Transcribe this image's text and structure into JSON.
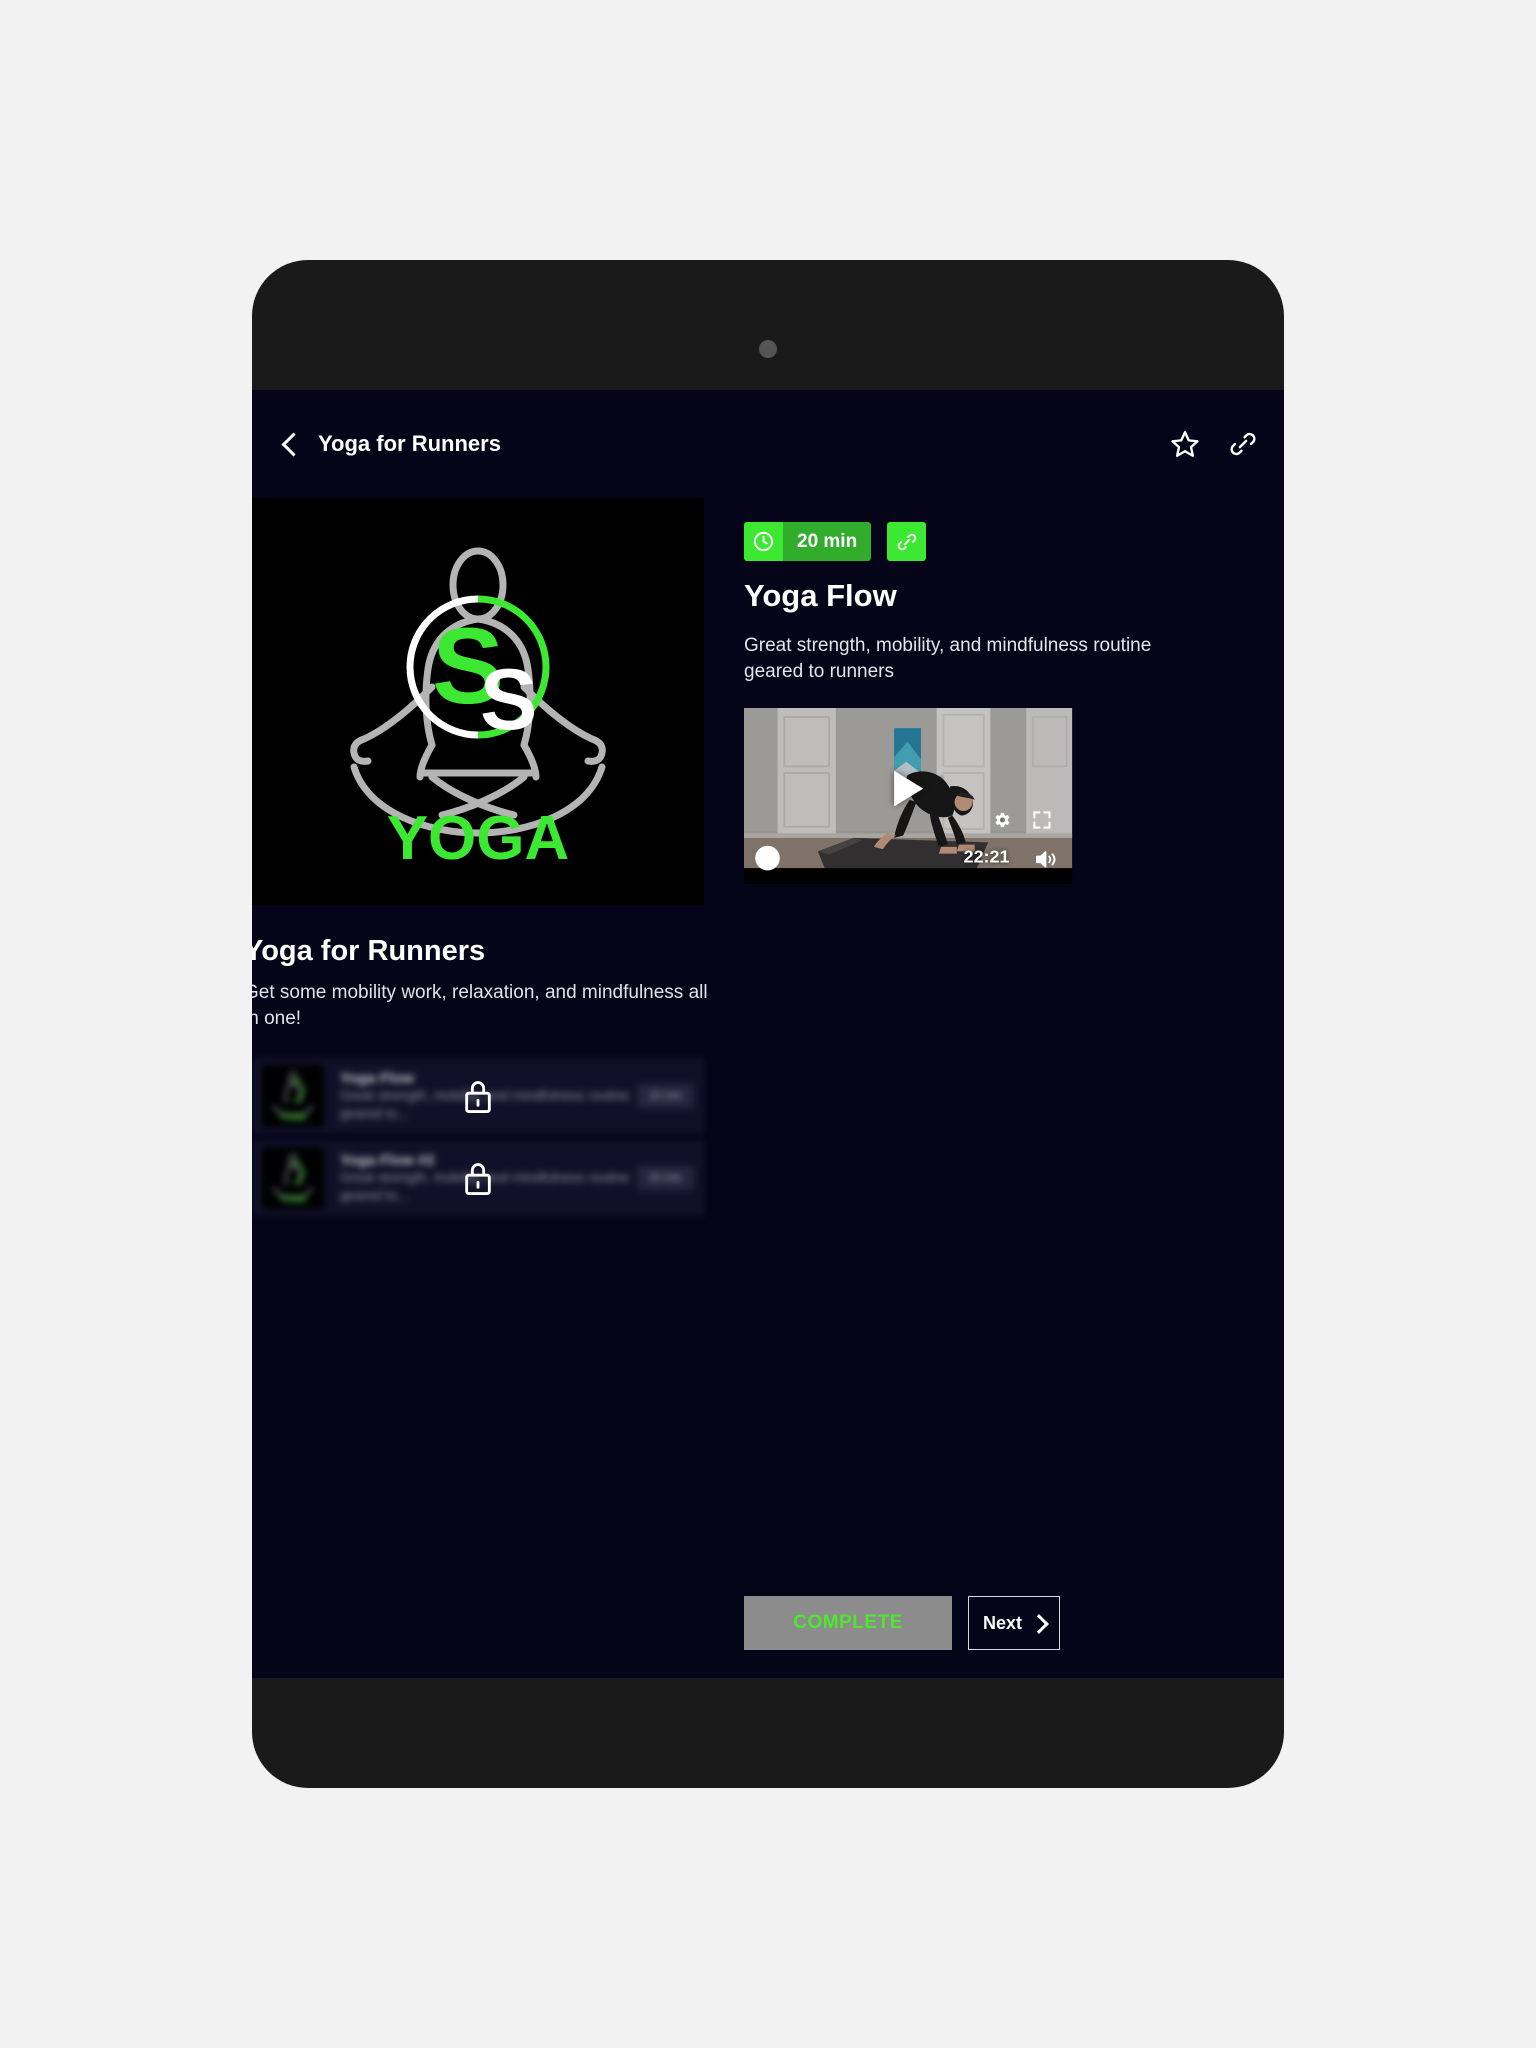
{
  "header": {
    "back_icon": "chevron-left-icon",
    "title": "Yoga for Runners",
    "favorite_icon": "star-icon",
    "share_icon": "link-icon"
  },
  "course": {
    "title": "Yoga for Runners",
    "description": "Get some mobility work, relaxation, and mindfulness all in one!",
    "logo": {
      "brand_letters": [
        "S",
        "S"
      ],
      "wordmark": "YOGA",
      "accent_color": "#3de832",
      "outline_color": "#b4b4b4"
    },
    "lessons": [
      {
        "name": "Yoga Flow",
        "subtitle": "Great strength, mobility, and mindfulness routine geared to...",
        "duration": "20 min",
        "locked": true,
        "lock_icon": "lock-icon"
      },
      {
        "name": "Yoga Flow #2",
        "subtitle": "Great strength, mobility, and mindfulness routine geared to...",
        "duration": "20 min",
        "locked": true,
        "lock_icon": "lock-icon"
      }
    ]
  },
  "lesson": {
    "duration_badge": {
      "clock_icon": "clock-icon",
      "label": "20 min",
      "bg_icon_color": "#3de832",
      "bg_label_color": "#32ad2b"
    },
    "share_button_icon": "link-icon",
    "title": "Yoga Flow",
    "description": "Great strength, mobility, and mindfulness routine geared to runners",
    "player": {
      "play_icon": "play-icon",
      "settings_icon": "gear-icon",
      "fullscreen_icon": "fullscreen-icon",
      "time": "22:21",
      "volume_icon": "volume-icon",
      "scrubber_icon": "scrubber-handle"
    }
  },
  "footer": {
    "complete_label": "COMPLETE",
    "complete_bg": "#8c8c8c",
    "complete_text_color": "#4de82e",
    "next_label": "Next",
    "next_icon": "chevron-right-icon"
  },
  "theme": {
    "page_bg": "#f2f2f2",
    "bezel": "#1a1a1a",
    "screen_bg": "#050418",
    "accent_green": "#3de832"
  }
}
